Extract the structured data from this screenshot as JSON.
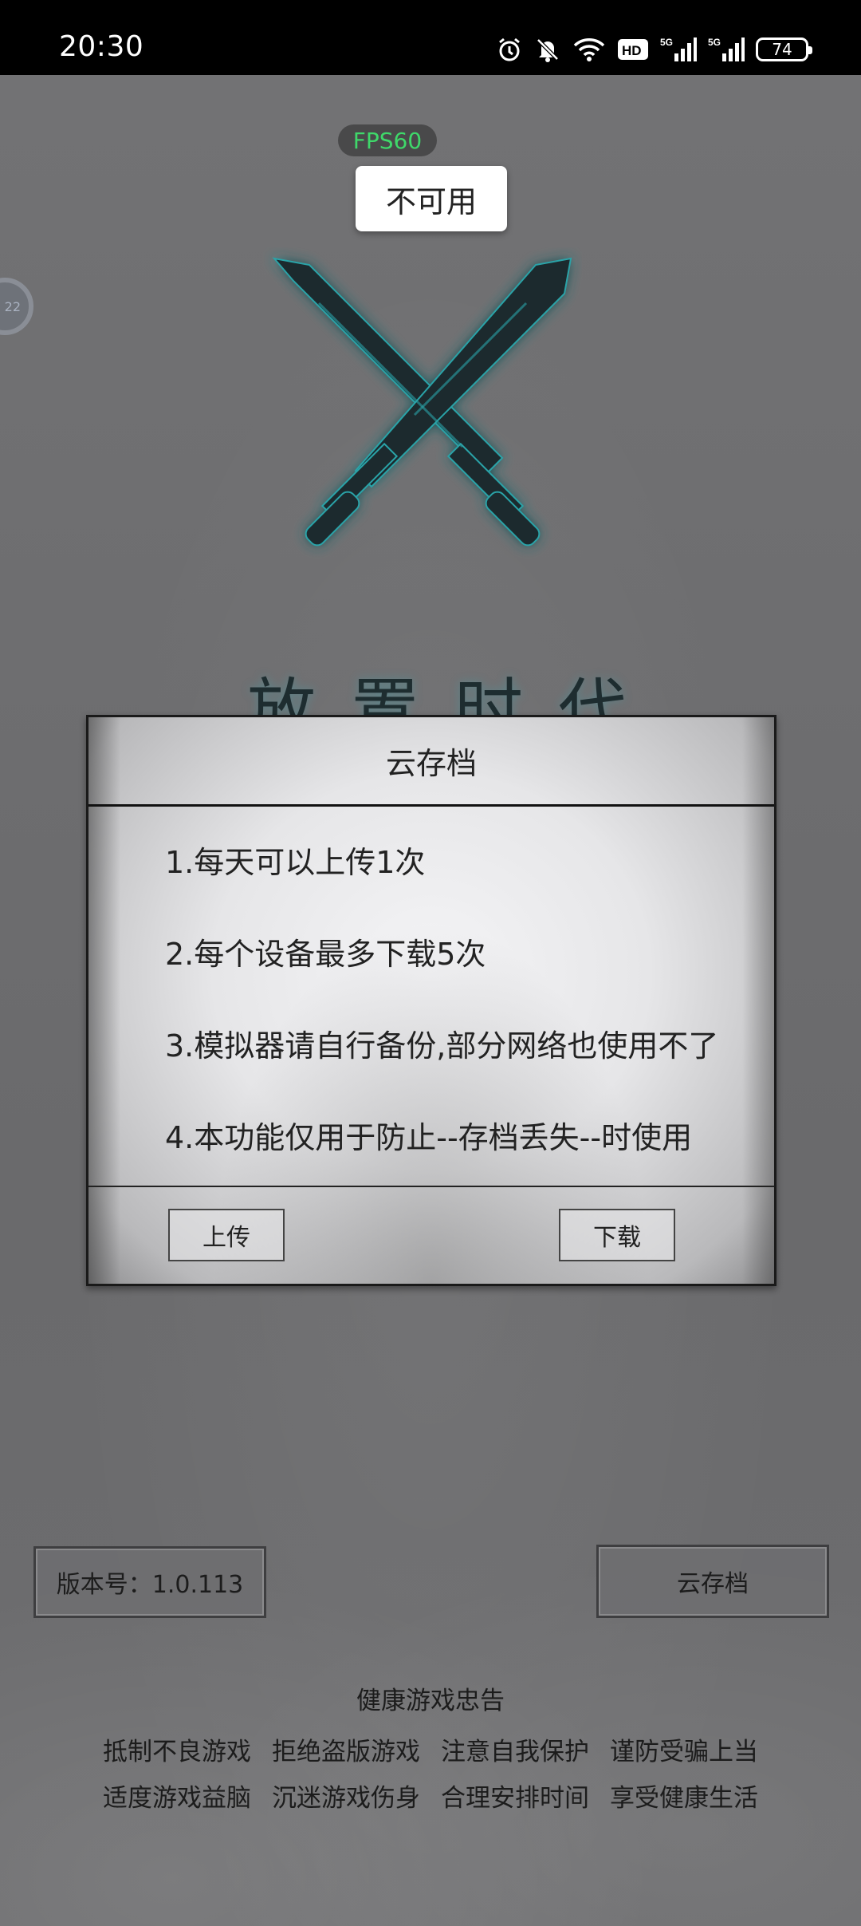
{
  "status_bar": {
    "time": "20:30",
    "icons": [
      "alarm-icon",
      "mute-bell-icon",
      "wifi-icon",
      "hd-icon",
      "signal-5g-icon",
      "signal-5g-icon"
    ],
    "battery": "74"
  },
  "overlay": {
    "fps": "FPS60",
    "toast": "不可用",
    "float_ball_text": "22"
  },
  "game": {
    "title": "放置时代",
    "logo_icon": "crossed-swords-icon",
    "accent_color": "#2aa3a8"
  },
  "dialog": {
    "title": "云存档",
    "rules": [
      "1.每天可以上传1次",
      "2.每个设备最多下载5次",
      "3.模拟器请自行备份,部分网络也使用不了",
      "4.本功能仅用于防止--存档丢失--时使用"
    ],
    "upload_label": "上传",
    "download_label": "下载"
  },
  "footer": {
    "version": "版本号：1.0.113",
    "cloud_save_label": "云存档",
    "health_title": "健康游戏忠告",
    "health_line1": [
      "抵制不良游戏",
      "拒绝盗版游戏",
      "注意自我保护",
      "谨防受骗上当"
    ],
    "health_line2": [
      "适度游戏益脑",
      "沉迷游戏伤身",
      "合理安排时间",
      "享受健康生活"
    ]
  }
}
